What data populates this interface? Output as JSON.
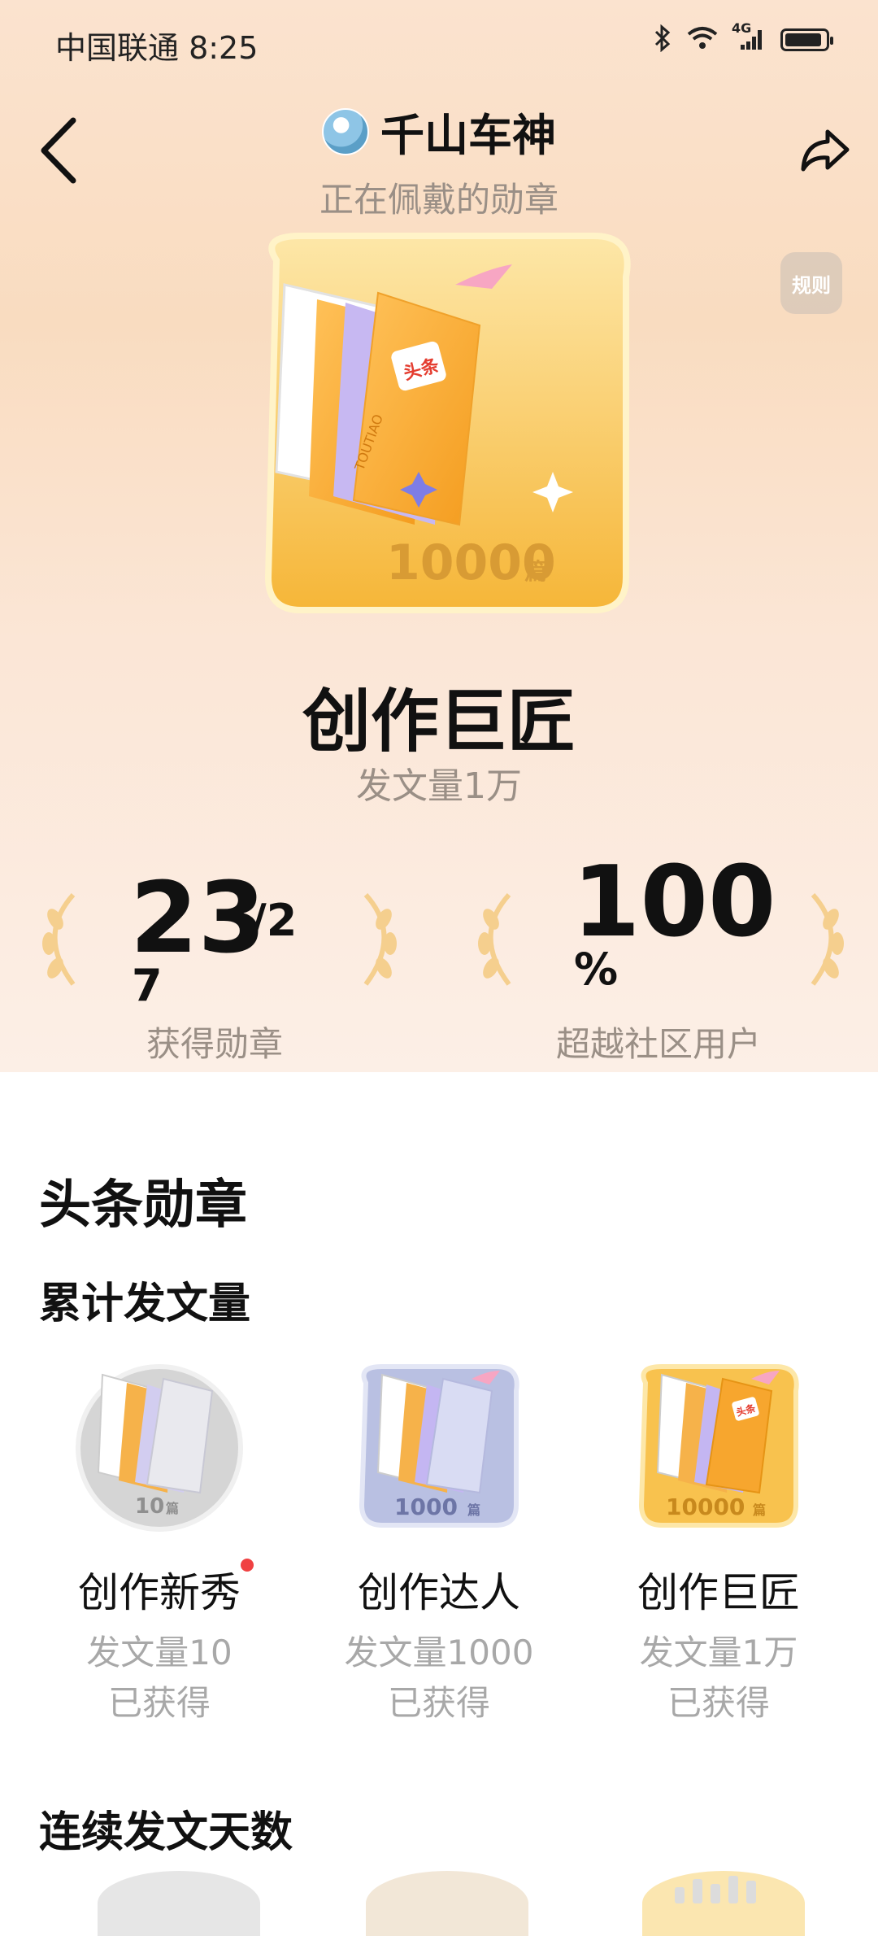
{
  "status_bar": {
    "carrier_time": "中国联通 8:25",
    "network": "4G"
  },
  "header": {
    "username": "千山车神",
    "subtitle": "正在佩戴的勋章",
    "rules_label": "规则"
  },
  "featured_badge": {
    "count_text": "10000",
    "unit": "篇",
    "brand": "头条",
    "brand_en": "TOUTIAO",
    "title": "创作巨匠",
    "desc": "发文量1万"
  },
  "stats": {
    "earned": {
      "value": "23",
      "total_top": "/2",
      "total_bottom": "7",
      "label": "获得勋章"
    },
    "rank": {
      "value": "100",
      "unit": "%",
      "label": "超越社区用户"
    }
  },
  "section": {
    "title": "头条勋章",
    "sub1": "累计发文量",
    "sub2": "连续发文天数"
  },
  "medals": [
    {
      "name": "创作新秀",
      "count": "10",
      "unit": "篇",
      "desc": "发文量10",
      "status": "已获得",
      "tier": "silver"
    },
    {
      "name": "创作达人",
      "count": "1000",
      "unit": "篇",
      "desc": "发文量1000",
      "status": "已获得",
      "tier": "blue"
    },
    {
      "name": "创作巨匠",
      "count": "10000",
      "unit": "篇",
      "desc": "发文量1万",
      "status": "已获得",
      "tier": "gold"
    }
  ],
  "colors": {
    "accent_red": "#f04142",
    "gold": "#f7b73a",
    "silver": "#c9c9c9",
    "blue": "#a9b3d8"
  }
}
